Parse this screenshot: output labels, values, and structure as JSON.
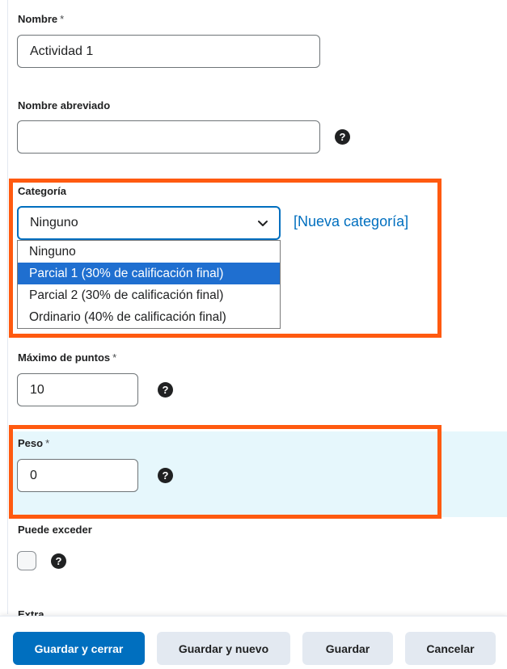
{
  "form": {
    "nombre": {
      "label": "Nombre",
      "required": "*",
      "value": "Actividad 1"
    },
    "nombre_abreviado": {
      "label": "Nombre abreviado",
      "value": ""
    },
    "categoria": {
      "label": "Categoría",
      "selected": "Ninguno",
      "new_link": "[Nueva categoría]",
      "options": [
        "Ninguno",
        "Parcial 1 (30% de calificación final)",
        "Parcial 2 (30% de calificación final)",
        "Ordinario (40% de calificación final)"
      ],
      "highlighted_option_index": 1
    },
    "maximo_puntos": {
      "label": "Máximo de puntos",
      "required": "*",
      "value": "10"
    },
    "peso": {
      "label": "Peso",
      "required": "*",
      "value": "0"
    },
    "puede_exceder": {
      "label": "Puede exceder",
      "checked": false
    },
    "extra": {
      "label": "Extra"
    }
  },
  "footer": {
    "save_close": "Guardar y cerrar",
    "save_new": "Guardar y nuevo",
    "save": "Guardar",
    "cancel": "Cancelar"
  },
  "icons": {
    "help": "help-circle-icon",
    "chevron": "chevron-down-icon"
  },
  "colors": {
    "accent": "#006fbf",
    "highlight_border": "#ff5a10",
    "selected_option": "#1f6fd0",
    "peso_background": "#e6f7fc"
  }
}
